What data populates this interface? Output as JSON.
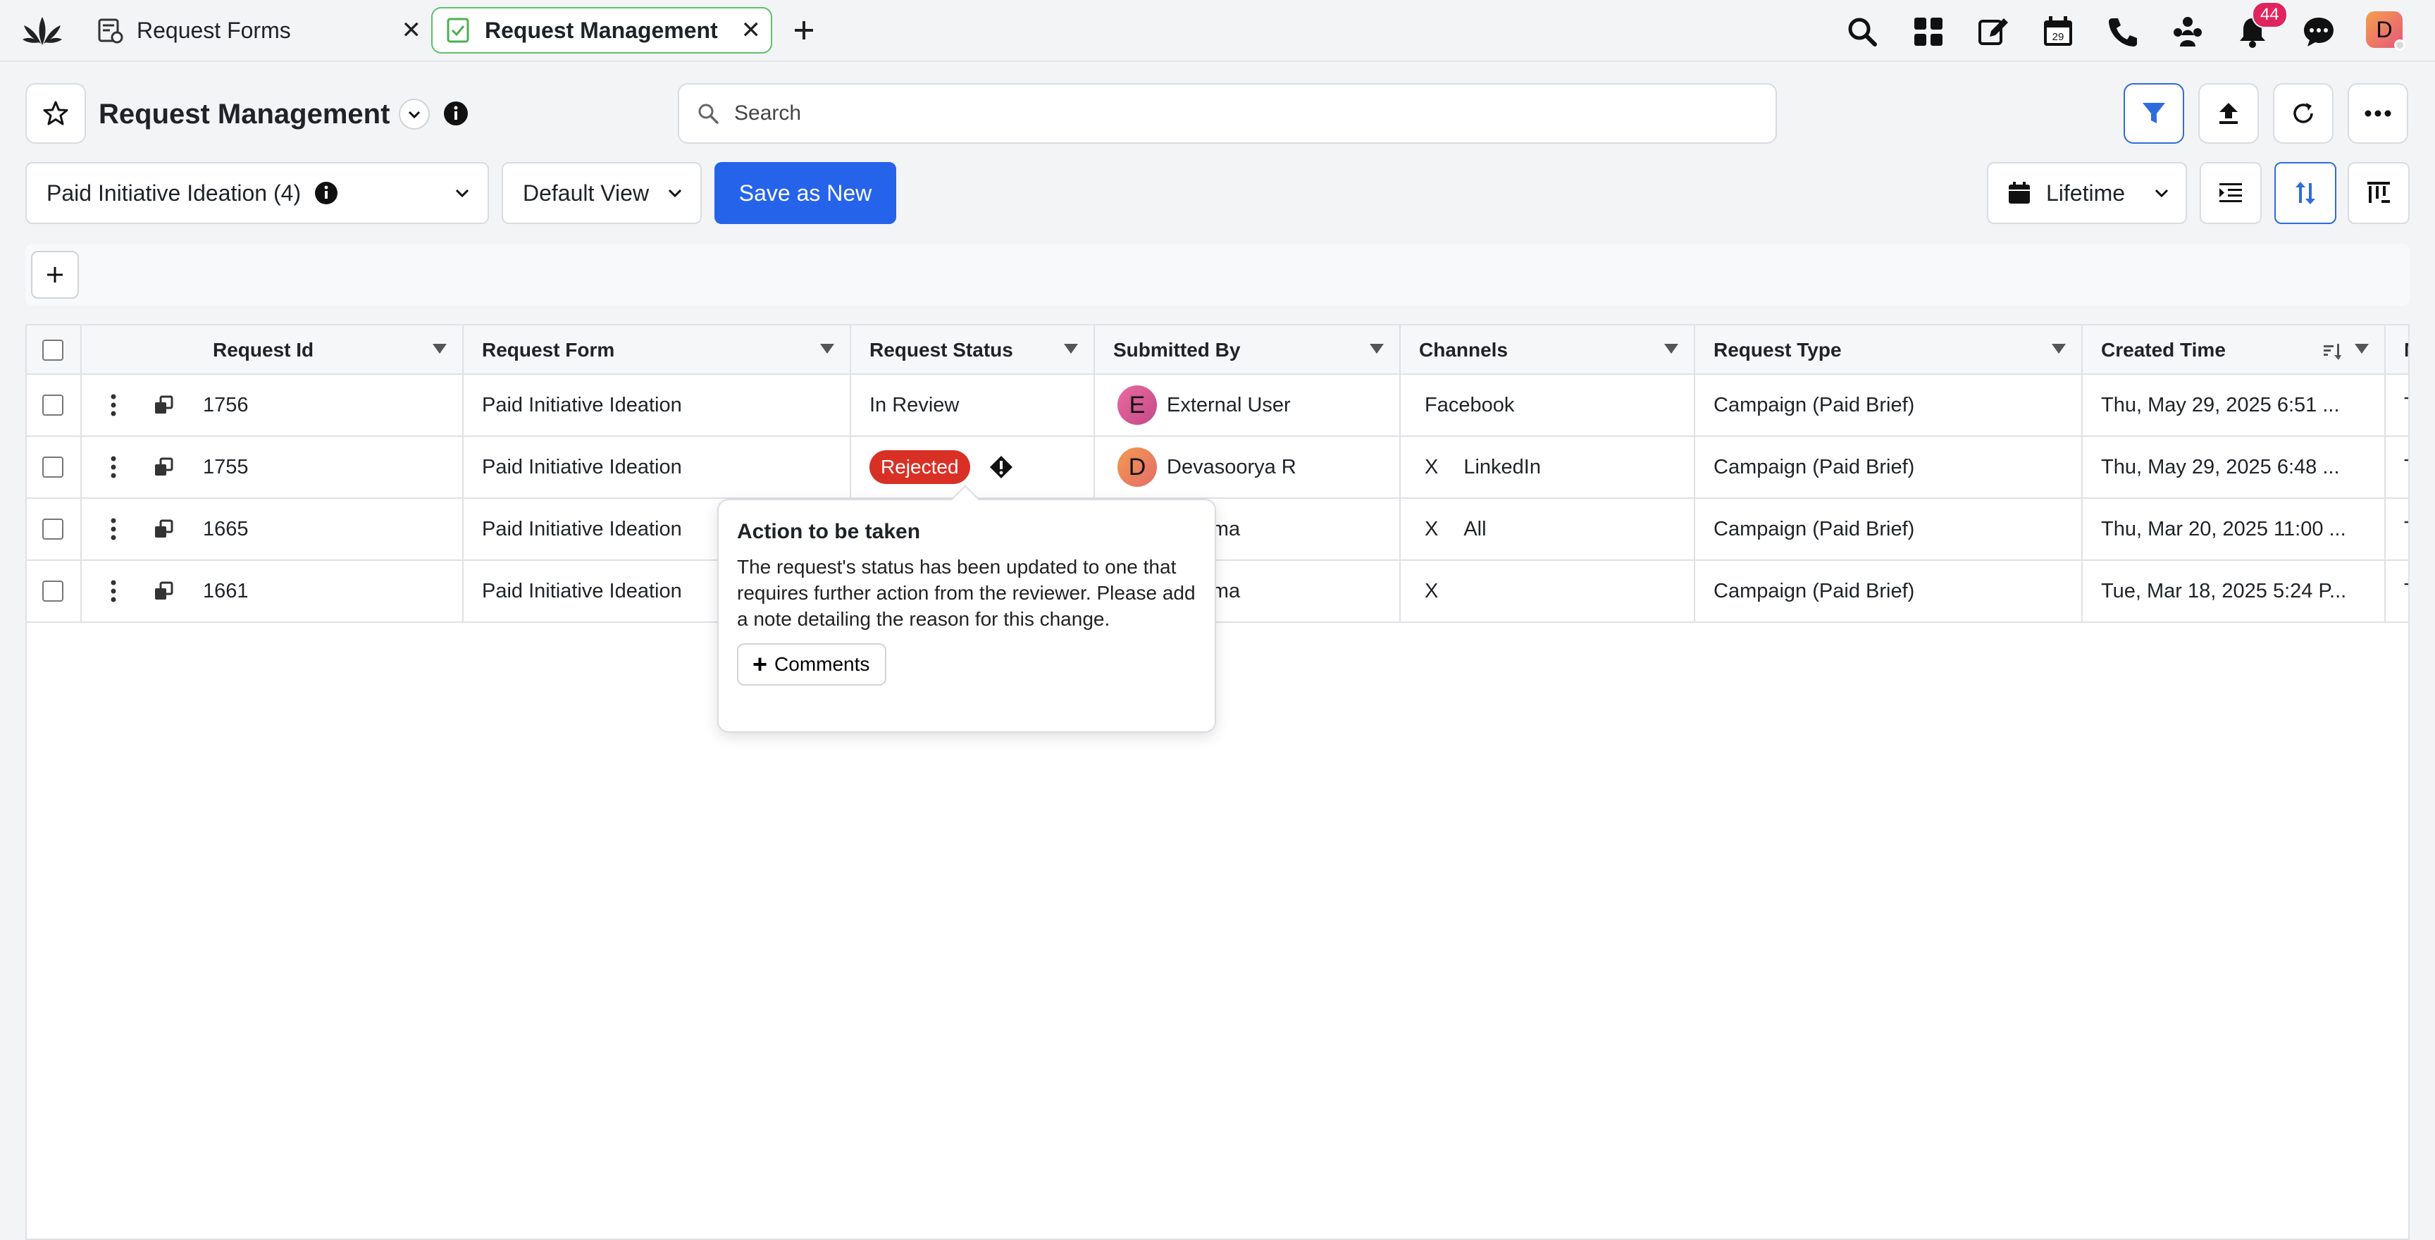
{
  "tabs": [
    {
      "label": "Request Forms",
      "active": false
    },
    {
      "label": "Request Management",
      "active": true
    }
  ],
  "notifications": {
    "count": "44"
  },
  "user": {
    "initial": "D"
  },
  "header": {
    "title": "Request Management"
  },
  "search": {
    "placeholder": "Search"
  },
  "view": {
    "selected": "Paid Initiative Ideation (4)",
    "default_view": "Default View",
    "save_as_new": "Save as New",
    "date_range": "Lifetime"
  },
  "table": {
    "columns": [
      "Request Id",
      "Request Form",
      "Request Status",
      "Submitted By",
      "Channels",
      "Request Type",
      "Created Time",
      "Mod"
    ],
    "rows": [
      {
        "id": "1756",
        "form": "Paid Initiative Ideation",
        "status": "In Review",
        "submitter_initial": "E",
        "submitter": "External User",
        "channel_prefix": "",
        "channel": "Facebook",
        "type": "Campaign (Paid Brief)",
        "created": "Thu, May 29, 2025 6:51 ...",
        "mod": "Thu"
      },
      {
        "id": "1755",
        "form": "Paid Initiative Ideation",
        "status": "Rejected",
        "submitter_initial": "D",
        "submitter": "Devasoorya R",
        "channel_prefix": "X",
        "channel": "LinkedIn",
        "type": "Campaign (Paid Brief)",
        "created": "Thu, May 29, 2025 6:48 ...",
        "mod": "Thu"
      },
      {
        "id": "1665",
        "form": "Paid Initiative Ideation",
        "status": "",
        "submitter_initial": "",
        "submitter": "erma",
        "channel_prefix": "X",
        "channel": "All",
        "type": "Campaign (Paid Brief)",
        "created": "Thu, Mar 20, 2025 11:00 ...",
        "mod": "Thu"
      },
      {
        "id": "1661",
        "form": "Paid Initiative Ideation",
        "status": "",
        "submitter_initial": "",
        "submitter": "erma",
        "channel_prefix": "X",
        "channel": "",
        "type": "Campaign (Paid Brief)",
        "created": "Tue, Mar 18, 2025 5:24 P...",
        "mod": "Thu"
      }
    ]
  },
  "popover": {
    "title": "Action to be taken",
    "body": "The request's status has been updated to one that requires further action from the reviewer. Please add a note detailing the reason for this change.",
    "button": "Comments"
  },
  "colors": {
    "primary": "#2563eb",
    "rejected": "#d93025",
    "active_tab_border": "#5cc26b",
    "badge": "#e0245e"
  }
}
